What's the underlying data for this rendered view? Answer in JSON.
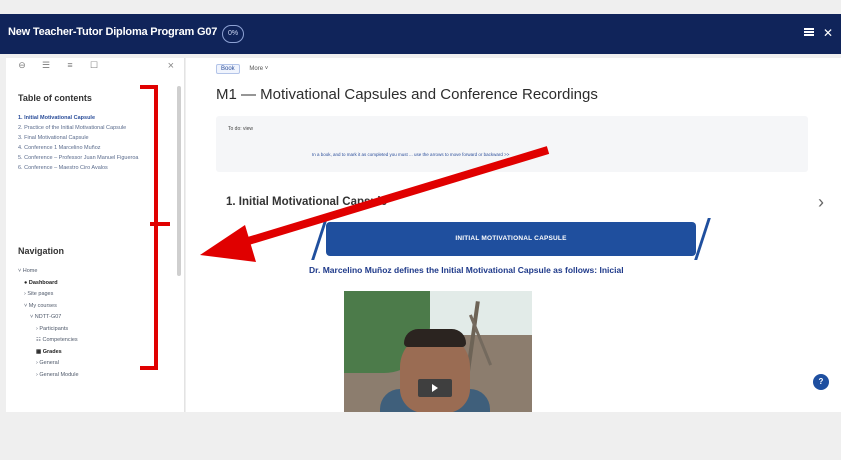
{
  "header": {
    "course_title": "New Teacher-Tutor Diploma Program G07",
    "progress_badge": "0%",
    "icons": [
      "menu-icon",
      "close-icon"
    ]
  },
  "sidebar": {
    "toolbar_icons": [
      "sidebar-view-icon",
      "list-view-icon",
      "grid-view-icon",
      "expand-icon"
    ],
    "close_label": "×",
    "toc": {
      "title": "Table of contents",
      "items": [
        "1. Initial Motivational Capsule",
        "2. Practice of the Initial Motivational Capsule",
        "3. Final Motivational Capsule",
        "4. Conference 1 Marcelino Muñoz",
        "5. Conference – Professor Juan Manuel Figueroa",
        "6. Conference – Maestro Ciro Avalos"
      ]
    },
    "navigation": {
      "title": "Navigation",
      "items": [
        "Home",
        "Dashboard",
        "Site pages",
        "My courses",
        "NDTT-G07",
        "Participants",
        "Competencies",
        "Grades",
        "General",
        "General Module"
      ]
    }
  },
  "main": {
    "tabs": [
      "Book",
      "More"
    ],
    "page_title": "M1 — Motivational Capsules and Conference Recordings",
    "info": {
      "todo": "To do: view",
      "hint": "In a book, and to mark it as completed you must ... use the arrows to move forward or backward >>"
    },
    "section_heading": "1. Initial Motivational Capsule",
    "banner_text": "INITIAL MOTIVATIONAL CAPSULE",
    "definition_text": "Dr. Marcelino Muñoz defines the Initial Motivational Capsule as follows: Inicial",
    "next_arrow": "›",
    "help_label": "?"
  },
  "colors": {
    "header_bg": "#10245a",
    "accent": "#1f4f9e",
    "annotation": "#e00000"
  }
}
